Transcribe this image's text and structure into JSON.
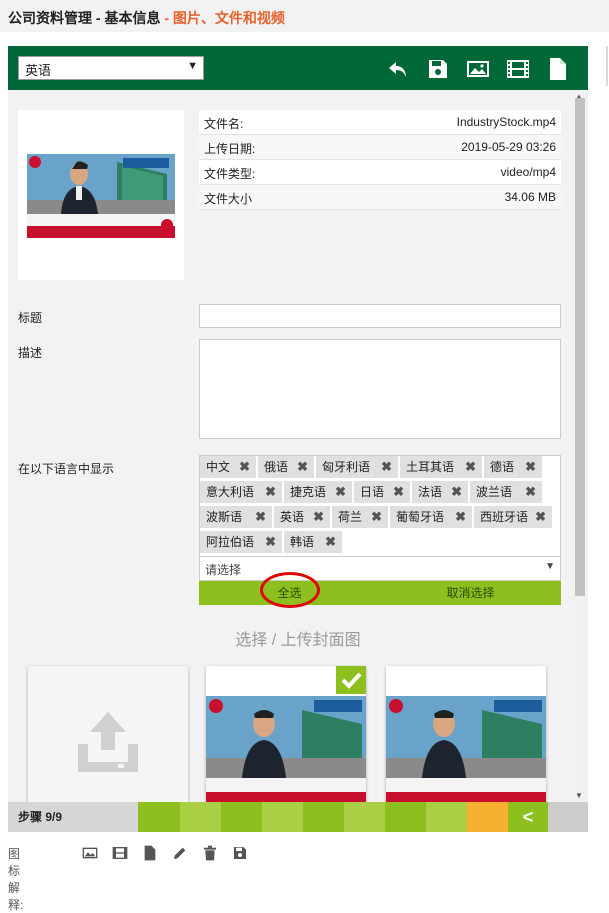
{
  "header": {
    "title_main": "公司资料管理 - 基本信息",
    "title_sub": "- 图片、文件和视频"
  },
  "toolbar": {
    "language_value": "英语",
    "icons": [
      "undo-icon",
      "save-icon",
      "image-icon",
      "film-icon",
      "document-icon"
    ]
  },
  "file_info": {
    "rows": [
      {
        "key": "文件名:",
        "value": "IndustryStock.mp4"
      },
      {
        "key": "上传日期:",
        "value": "2019-05-29 03:26"
      },
      {
        "key": "文件类型:",
        "value": "video/mp4"
      },
      {
        "key": "文件大小",
        "value": "34.06 MB"
      }
    ]
  },
  "form": {
    "title_label": "标题",
    "title_value": "",
    "desc_label": "描述",
    "desc_value": "",
    "langs_label": "在以下语言中显示",
    "tags": [
      "中文",
      "俄语",
      "匈牙利语",
      "土耳其语",
      "德语",
      "意大利语",
      "捷克语",
      "日语",
      "法语",
      "波兰语",
      "波斯语",
      "英语",
      "荷兰",
      "葡萄牙语",
      "西班牙语",
      "阿拉伯语",
      "韩语"
    ],
    "select_placeholder": "请选择",
    "select_all": "全选",
    "deselect_all": "取消选择"
  },
  "cover": {
    "title": "选择 / 上传封面图"
  },
  "steps": {
    "label": "步骤 9/9",
    "back_glyph": "<"
  },
  "legend": {
    "label": "图标解释:",
    "icons": [
      "image-icon",
      "film-icon",
      "document-icon",
      "pencil-icon",
      "trash-icon",
      "save-icon"
    ]
  },
  "colors": {
    "dark_green": "#006837",
    "light_green": "#8dc01f",
    "orange": "#f7b030",
    "accent_red": "#e8612c"
  }
}
